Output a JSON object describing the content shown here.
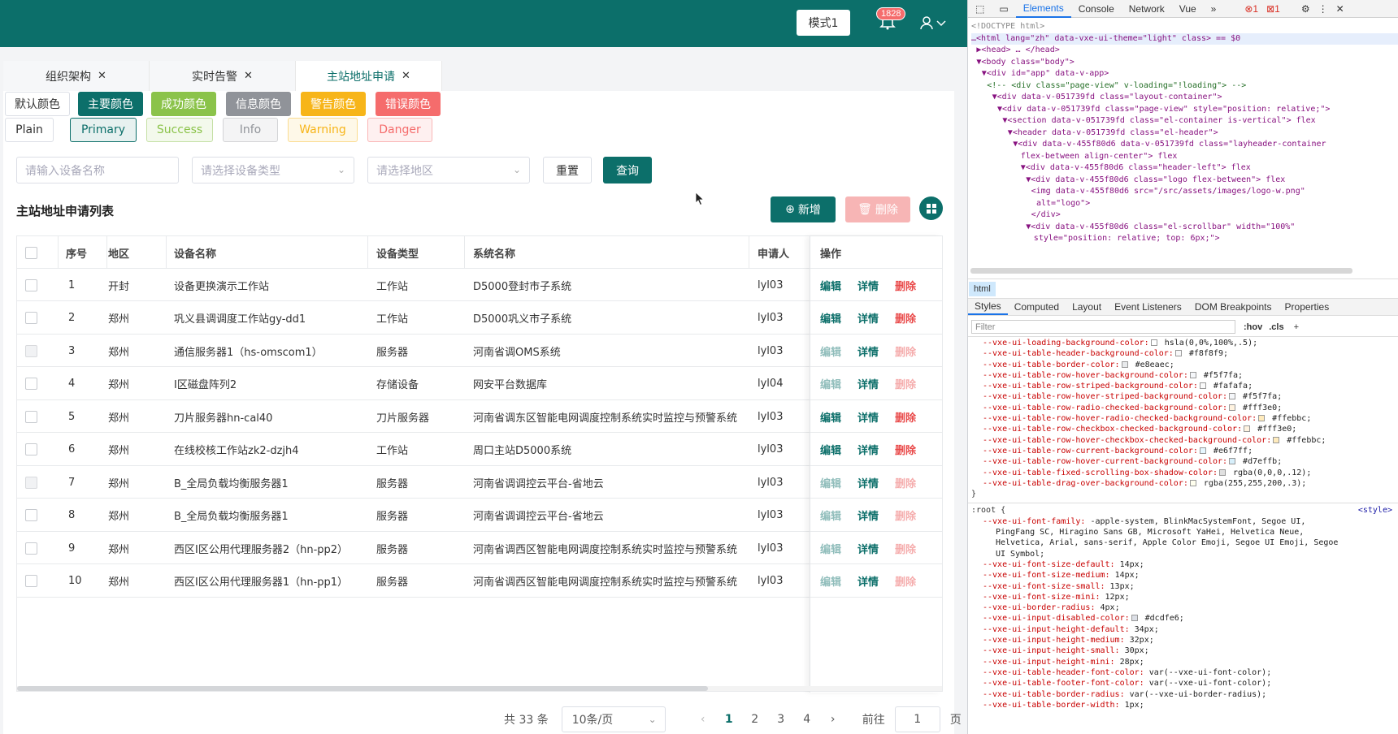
{
  "header": {
    "mode_label": "模式1",
    "notification_count": "1828"
  },
  "tabs": [
    {
      "label": "组织架构"
    },
    {
      "label": "实时告警"
    },
    {
      "label": "主站地址申请"
    }
  ],
  "color_buttons": [
    "默认颜色",
    "主要颜色",
    "成功颜色",
    "信息颜色",
    "警告颜色",
    "错误颜色"
  ],
  "plain_buttons": [
    "Plain",
    "Primary",
    "Success",
    "Info",
    "Warning",
    "Danger"
  ],
  "search": {
    "device_name_placeholder": "请输入设备名称",
    "device_type_placeholder": "请选择设备类型",
    "region_placeholder": "请选择地区",
    "reset_label": "重置",
    "query_label": "查询"
  },
  "list": {
    "title": "主站地址申请列表",
    "add_label": "新增",
    "delete_label": "删除"
  },
  "table": {
    "headers": [
      "序号",
      "地区",
      "设备名称",
      "设备类型",
      "系统名称",
      "申请人",
      "操作"
    ],
    "action_labels": {
      "edit": "编辑",
      "detail": "详情",
      "delete": "删除"
    },
    "rows": [
      {
        "no": "1",
        "region": "开封",
        "name": "设备更换演示工作站",
        "type": "工作站",
        "system": "D5000登封市子系统",
        "applicant": "lyl03",
        "disabled": false
      },
      {
        "no": "2",
        "region": "郑州",
        "name": "巩义县调调度工作站gy-dd1",
        "type": "工作站",
        "system": "D5000巩义市子系统",
        "applicant": "lyl03",
        "disabled": false
      },
      {
        "no": "3",
        "region": "郑州",
        "name": "通信服务器1（hs-omscom1）",
        "type": "服务器",
        "system": "河南省调OMS系统",
        "applicant": "lyl03",
        "disabled": true
      },
      {
        "no": "4",
        "region": "郑州",
        "name": "I区磁盘阵列2",
        "type": "存储设备",
        "system": "网安平台数据库",
        "applicant": "lyl04",
        "disabled": true
      },
      {
        "no": "5",
        "region": "郑州",
        "name": "刀片服务器hn-cal40",
        "type": "刀片服务器",
        "system": "河南省调东区智能电网调度控制系统实时监控与预警系统",
        "applicant": "lyl03",
        "disabled": false
      },
      {
        "no": "6",
        "region": "郑州",
        "name": "在线校核工作站zk2-dzjh4",
        "type": "工作站",
        "system": "周口主站D5000系统",
        "applicant": "lyl03",
        "disabled": false
      },
      {
        "no": "7",
        "region": "郑州",
        "name": "B_全局负载均衡服务器1",
        "type": "服务器",
        "system": "河南省调调控云平台-省地云",
        "applicant": "lyl03",
        "disabled": true
      },
      {
        "no": "8",
        "region": "郑州",
        "name": "B_全局负载均衡服务器1",
        "type": "服务器",
        "system": "河南省调调控云平台-省地云",
        "applicant": "lyl03",
        "disabled": true
      },
      {
        "no": "9",
        "region": "郑州",
        "name": "西区I区公用代理服务器2（hn-pp2）",
        "type": "服务器",
        "system": "河南省调西区智能电网调度控制系统实时监控与预警系统",
        "applicant": "lyl03",
        "disabled": true
      },
      {
        "no": "10",
        "region": "郑州",
        "name": "西区I区公用代理服务器1（hn-pp1）",
        "type": "服务器",
        "system": "河南省调西区智能电网调度控制系统实时监控与预警系统",
        "applicant": "lyl03",
        "disabled": true
      }
    ]
  },
  "pager": {
    "total": "共 33 条",
    "page_size": "10条/页",
    "pages": [
      "1",
      "2",
      "3",
      "4"
    ],
    "current": "1",
    "goto_label": "前往",
    "goto_value": "1",
    "page_suffix": "页"
  },
  "devtools": {
    "tabs": [
      "Elements",
      "Console",
      "Network",
      "Vue"
    ],
    "error_count": "1",
    "issue_count": "1",
    "dom_lines": [
      "<!DOCTYPE html>",
      "…<html lang=\"zh\" data-vxe-ui-theme=\"light\" class> == $0",
      "▶<head> … </head>",
      "▼<body class=\"body\">",
      "▼<div id=\"app\" data-v-app>",
      "<!-- <div class=\"page-view\" v-loading=\"!loading\"> -->",
      "▼<div data-v-051739fd class=\"layout-container\">",
      "▼<div data-v-051739fd class=\"page-view\" style=\"position: relative;\">",
      "▼<section data-v-051739fd class=\"el-container is-vertical\"> flex",
      "▼<header data-v-051739fd class=\"el-header\">",
      "▼<div data-v-455f80d6 data-v-051739fd class=\"layheader-container",
      "flex-between align-center\"> flex",
      "▼<div data-v-455f80d6 class=\"header-left\"> flex",
      "▼<div data-v-455f80d6 class=\"logo flex-between\"> flex",
      "<img data-v-455f80d6 src=\"/src/assets/images/logo-w.png\"",
      "alt=\"logo\">",
      "</div>",
      "▼<div data-v-455f80d6 class=\"el-scrollbar\" width=\"100%\"",
      "style=\"position: relative; top: 6px;\">"
    ],
    "crumb": "html",
    "style_tabs": [
      "Styles",
      "Computed",
      "Layout",
      "Event Listeners",
      "DOM Breakpoints",
      "Properties"
    ],
    "filter_placeholder": "Filter",
    "filter_tools": [
      ":hov",
      ".cls"
    ],
    "style_lines_a": [
      [
        "--vxe-ui-loading-background-color:",
        "hsla(0,0%,100%,.5);"
      ],
      [
        "--vxe-ui-table-header-background-color:",
        "#f8f8f9;"
      ],
      [
        "--vxe-ui-table-border-color:",
        "#e8eaec;"
      ],
      [
        "--vxe-ui-table-row-hover-background-color:",
        "#f5f7fa;"
      ],
      [
        "--vxe-ui-table-row-striped-background-color:",
        "#fafafa;"
      ],
      [
        "--vxe-ui-table-row-hover-striped-background-color:",
        "#f5f7fa;"
      ],
      [
        "--vxe-ui-table-row-radio-checked-background-color:",
        "#fff3e0;"
      ],
      [
        "--vxe-ui-table-row-hover-radio-checked-background-color:",
        "#ffebbc;"
      ],
      [
        "--vxe-ui-table-row-checkbox-checked-background-color:",
        "#fff3e0;"
      ],
      [
        "--vxe-ui-table-row-hover-checkbox-checked-background-color:",
        "#ffebbc;"
      ],
      [
        "--vxe-ui-table-row-current-background-color:",
        "#e6f7ff;"
      ],
      [
        "--vxe-ui-table-row-hover-current-background-color:",
        "#d7effb;"
      ],
      [
        "--vxe-ui-table-fixed-scrolling-box-shadow-color:",
        "rgba(0,0,0,.12);"
      ],
      [
        "--vxe-ui-table-drag-over-background-color:",
        "rgba(255,255,200,.3);"
      ]
    ],
    "root_selector": ":root {",
    "style_source": "<style>",
    "style_lines_b": [
      [
        "--vxe-ui-font-family:",
        "-apple-system, BlinkMacSystemFont, Segoe UI,"
      ],
      [
        "",
        "PingFang SC, Hiragino Sans GB, Microsoft YaHei, Helvetica Neue,"
      ],
      [
        "",
        "Helvetica, Arial, sans-serif, Apple Color Emoji, Segoe UI Emoji, Segoe"
      ],
      [
        "",
        "UI Symbol;"
      ],
      [
        "--vxe-ui-font-size-default:",
        "14px;"
      ],
      [
        "--vxe-ui-font-size-medium:",
        "14px;"
      ],
      [
        "--vxe-ui-font-size-small:",
        "13px;"
      ],
      [
        "--vxe-ui-font-size-mini:",
        "12px;"
      ],
      [
        "--vxe-ui-border-radius:",
        "4px;"
      ],
      [
        "--vxe-ui-input-disabled-color:",
        "#dcdfe6;"
      ],
      [
        "--vxe-ui-input-height-default:",
        "34px;"
      ],
      [
        "--vxe-ui-input-height-medium:",
        "32px;"
      ],
      [
        "--vxe-ui-input-height-small:",
        "30px;"
      ],
      [
        "--vxe-ui-input-height-mini:",
        "28px;"
      ],
      [
        "--vxe-ui-table-header-font-color:",
        "var(--vxe-ui-font-color);"
      ],
      [
        "--vxe-ui-table-footer-font-color:",
        "var(--vxe-ui-font-color);"
      ],
      [
        "--vxe-ui-table-border-radius:",
        "var(--vxe-ui-border-radius);"
      ],
      [
        "--vxe-ui-table-border-width:",
        "1px;"
      ]
    ]
  },
  "colors": {
    "primary": "#0c6f6a",
    "success": "#8bc34a",
    "info": "#909399",
    "warning": "#f7b519",
    "danger": "#f56c6c"
  }
}
